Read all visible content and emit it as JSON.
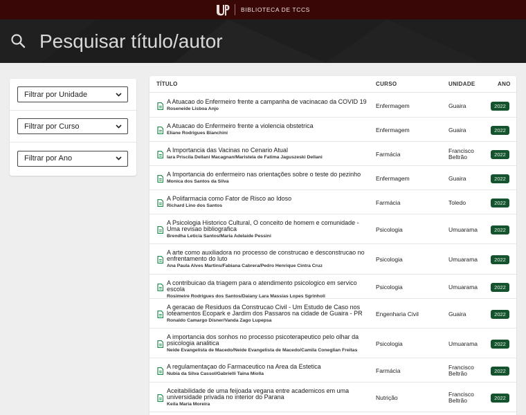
{
  "header": {
    "brand": "BIBLIOTECA DE TCCS"
  },
  "search": {
    "placeholder": "Pesquisar título/autor"
  },
  "filters": {
    "unidade": "Filtrar por Unidade",
    "curso": "Filtrar por Curso",
    "ano": "Filtrar por Ano"
  },
  "table": {
    "headers": {
      "titulo": "TÍTULO",
      "curso": "CURSO",
      "unidade": "UNIDADE",
      "ano": "ANO"
    },
    "rows": [
      {
        "title": "A Atuacao do Enfermeiro frente a campanha de vacinacao da COVID 19",
        "authors": "Roseneide Lisboa Anjo",
        "course": "Enfermagem",
        "unit": "Guaira",
        "year": "2022"
      },
      {
        "title": "A Atuacao do Enfermeiro frente a violencia obstetrica",
        "authors": "Eliane Rodrigues Bianchini",
        "course": "Enfermagem",
        "unit": "Guaira",
        "year": "2022"
      },
      {
        "title": "A Importancia das Vacinas no Cenario Atual",
        "authors": "Iara Priscila Dellani Macagnan/Maristela de Fatima Jaguszeski Dellani",
        "course": "Farmácia",
        "unit": "Francisco Beltrão",
        "year": "2022"
      },
      {
        "title": "A Importancia do enfermeiro nas orientações sobre o teste do pezinho",
        "authors": "Monica dos Santos da Silva",
        "course": "Enfermagem",
        "unit": "Guaira",
        "year": "2022"
      },
      {
        "title": "A Polifarmacia como Fator de Risco ao Idoso",
        "authors": "Richard Lino dos Santos",
        "course": "Farmácia",
        "unit": "Toledo",
        "year": "2022"
      },
      {
        "title": "A Psicologia Historico Cultural, O conceito de homem e comunidade - Uma revisao bibliografica",
        "authors": "Brendha Leticia Santos/Maria Adelaide Pessini",
        "course": "Psicologia",
        "unit": "Umuarama",
        "year": "2022"
      },
      {
        "title": "A arte como auxiliadora no processo de construcao e desconstrucao no enfrentamento do luto",
        "authors": "Ana Paula Alves Martins/Fabiana Cabrera/Pedro Henrique Cintra Cruz",
        "course": "Psicologia",
        "unit": "Umuarama",
        "year": "2022"
      },
      {
        "title": "A contribuicao da triagem para o atendimento psicologico em servico escola",
        "authors": "Rosimeire Rodrigues dos Santos/Daiany Lara Massias Lopes Sgrinholi",
        "course": "Psicologia",
        "unit": "Umuarama",
        "year": "2022"
      },
      {
        "title": "A geracao de Residuos da Construcao Civil - Um Estudo de Caso nos loteamentos Ecopark e Jardim dos Passaros na cidade de Guaira - PR",
        "authors": "Ronaldo Camargo Disner/Vanda Zago Lupepsa",
        "course": "Engenharia Civil",
        "unit": "Guaira",
        "year": "2022"
      },
      {
        "title": "A importancia dos sonhos no processo psicoterapeutico pelo olhar da psicologia analitica",
        "authors": "Neide Evangelista de Macedo/Neide Evangelista de Macedo/Camila Coneglian Freitas",
        "course": "Psicologia",
        "unit": "Umuarama",
        "year": "2022"
      },
      {
        "title": "A regulamentaçao do Farmaceutico na Area da Estetica",
        "authors": "Nubia da Silva Cassol/Gabrielli Taina Miolla",
        "course": "Farmácia",
        "unit": "Francisco Beltrão",
        "year": "2022"
      },
      {
        "title": "Aceitabilidade de uma feijoada vegana entre academicos em uma universidade privada no interior do Parana",
        "authors": "Keila Maria Moreira",
        "course": "Nutrição",
        "unit": "Francisco Beltrão",
        "year": "2022"
      }
    ]
  }
}
